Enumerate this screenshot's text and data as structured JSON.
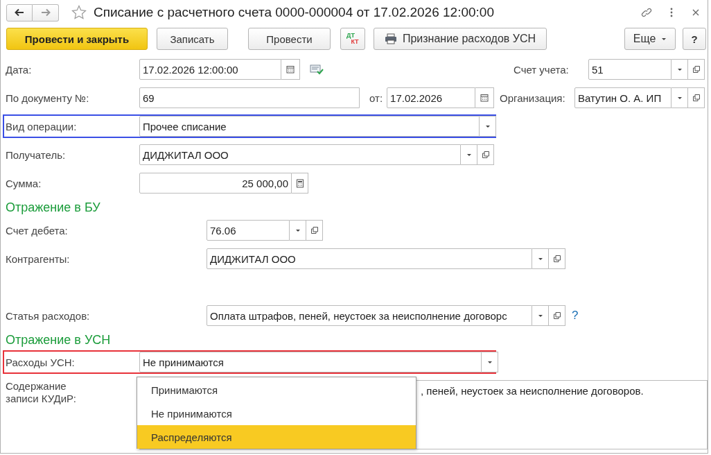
{
  "window": {
    "title": "Списание с расчетного счета 0000-000004 от 17.02.2026 12:00:00",
    "starred": false
  },
  "toolbar": [
    {
      "kind": "primary",
      "label": "Провести и закрыть"
    },
    {
      "kind": "plain",
      "label": "Записать"
    },
    {
      "kind": "plain",
      "label": "Провести"
    },
    {
      "kind": "dtkt",
      "top": "ДТ",
      "bottom": "КТ"
    },
    {
      "kind": "print",
      "label": "Признание расходов УСН"
    },
    {
      "kind": "menu",
      "label": "Еще"
    },
    {
      "kind": "plain",
      "label": "?"
    }
  ],
  "date": {
    "label": "Дата:",
    "value": "17.02.2026 12:00:00"
  },
  "account": {
    "label": "Счет учета:",
    "value": "51"
  },
  "doc_number": {
    "label": "По документу №:",
    "value": "69"
  },
  "doc_date": {
    "label": "от:",
    "value": "17.02.2026"
  },
  "organization": {
    "label": "Организация:",
    "value": "Ватутин О. А. ИП"
  },
  "operation": {
    "label": "Вид операции:",
    "value": "Прочее списание",
    "color": "#3a4fe6"
  },
  "recipient": {
    "label": "Получатель:",
    "value": "ДИДЖИТАЛ ООО"
  },
  "amount": {
    "label": "Сумма:",
    "value": "25 000,00"
  },
  "bu": {
    "heading": "Отражение в БУ",
    "debit_account": {
      "label": "Счет дебета:",
      "value": "76.06"
    },
    "counterparties": {
      "label": "Контрагенты:",
      "value": "ДИДЖИТАЛ ООО"
    },
    "expense_item": {
      "label": "Статья расходов:",
      "value": "Оплата штрафов, пеней, неустоек за неисполнение договорс",
      "help": "?"
    }
  },
  "usn": {
    "heading": "Отражение в УСН",
    "expenses": {
      "label": "Расходы УСН:",
      "value": "Не принимаются",
      "color": "#e8323a",
      "options": [
        {
          "label": "Принимаются",
          "highlighted": false
        },
        {
          "label": "Не принимаются",
          "highlighted": false
        },
        {
          "label": "Распределяются",
          "highlighted": true
        }
      ]
    },
    "kudir": {
      "label": "Содержание записи КУДиР:",
      "value": ", пеней, неустоек за неисполнение договоров."
    }
  }
}
